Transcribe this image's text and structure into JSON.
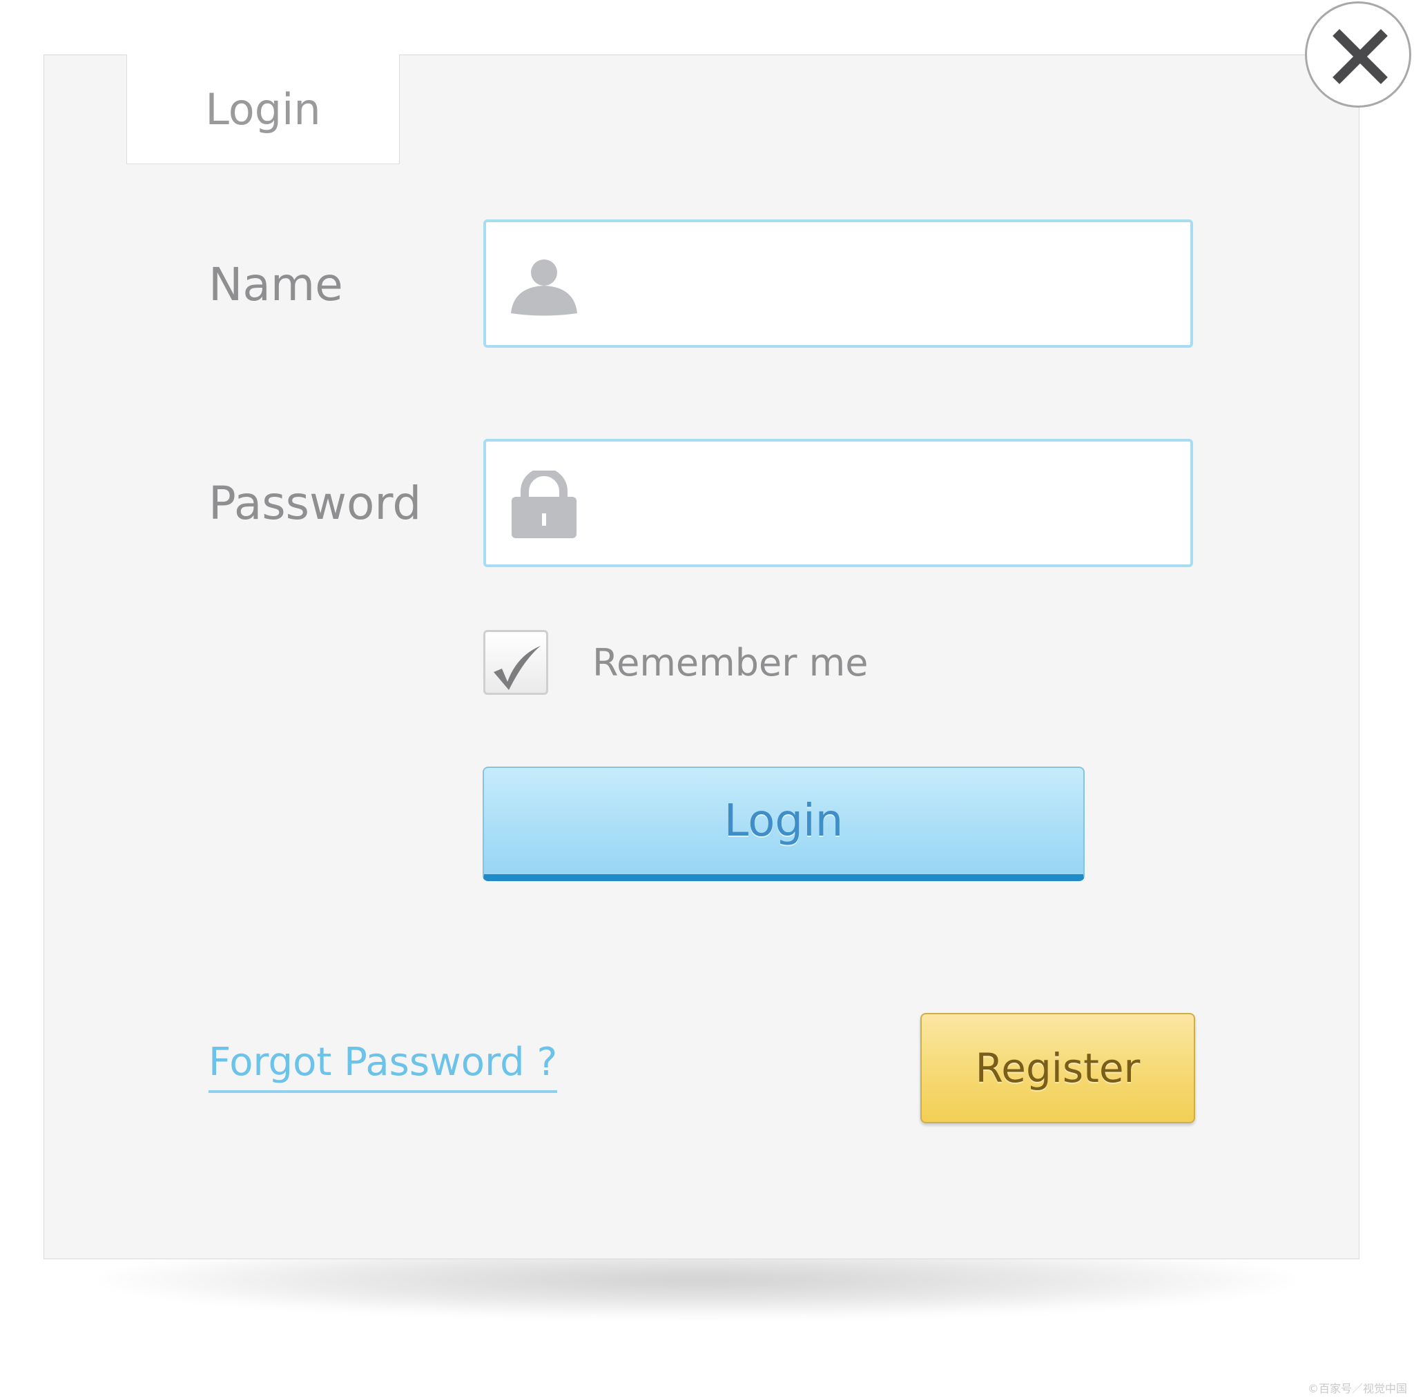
{
  "dialog": {
    "tab_label": "Login",
    "name_label": "Name",
    "password_label": "Password",
    "name_value": "",
    "password_value": "",
    "remember_label": "Remember me",
    "remember_checked": true,
    "login_button": "Login",
    "forgot_link": "Forgot Password ?",
    "register_button": "Register",
    "colors": {
      "field_border": "#a7ddf3",
      "login_button": "#a9def7",
      "login_text": "#3f8ec8",
      "link": "#6cc2e8",
      "register_button": "#f6d870"
    }
  },
  "icons": {
    "close": "close-icon",
    "user": "user-icon",
    "lock": "lock-icon",
    "check": "checkmark-icon"
  },
  "watermark": "©百家号／视觉中国"
}
